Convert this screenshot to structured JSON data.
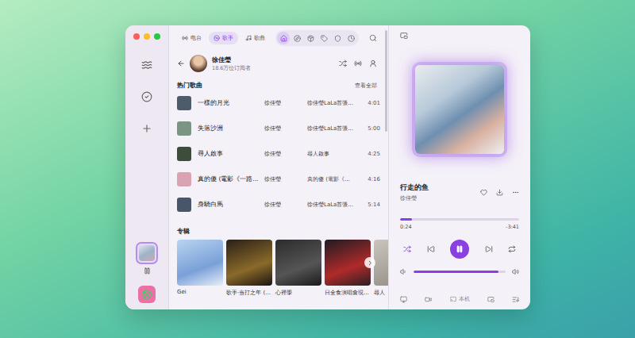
{
  "sidebar": {
    "items": [
      {
        "kind": "waves",
        "selected": false
      },
      {
        "kind": "check",
        "selected": false
      },
      {
        "kind": "plus",
        "selected": false
      }
    ],
    "now_playing_selected": true
  },
  "tabs": [
    {
      "label": "电台",
      "kind": "radio",
      "selected": false
    },
    {
      "label": "歌手",
      "kind": "disc",
      "selected": true
    },
    {
      "label": "歌曲",
      "kind": "music",
      "selected": false
    }
  ],
  "nav_icons": [
    {
      "kind": "home",
      "selected": true
    },
    {
      "kind": "compass",
      "selected": false
    },
    {
      "kind": "package",
      "selected": false
    },
    {
      "kind": "tag",
      "selected": false
    },
    {
      "kind": "shield",
      "selected": false
    },
    {
      "kind": "clock",
      "selected": false
    }
  ],
  "artist": {
    "name": "徐佳瑩",
    "subscribers": "18.6万位订阅者"
  },
  "popular": {
    "title": "热门歌曲",
    "see_all": "查看全部",
    "rows": [
      {
        "title": "一樣的月光",
        "artist": "徐佳瑩",
        "album": "徐佳瑩LaLa首張...",
        "duration": "4:01"
      },
      {
        "title": "失落沙洲",
        "artist": "徐佳瑩",
        "album": "徐佳瑩LaLa首張...",
        "duration": "5:00"
      },
      {
        "title": "尋人啟事",
        "artist": "徐佳瑩",
        "album": "尋人啟事",
        "duration": "4:25"
      },
      {
        "title": "真的傻 (電影《一路...",
        "artist": "徐佳瑩",
        "album": "真的傻 (電影《...",
        "duration": "4:16"
      },
      {
        "title": "身騎白馬",
        "artist": "徐佳瑩",
        "album": "徐佳瑩LaLa首張...",
        "duration": "5:14"
      }
    ]
  },
  "albums": {
    "title": "专辑",
    "items": [
      {
        "title": "Gei"
      },
      {
        "title": "歌手·当打之年 (..."
      },
      {
        "title": "心裡學"
      },
      {
        "title": "日全食演唱會現..."
      },
      {
        "title": "尋人"
      }
    ]
  },
  "now_playing": {
    "title": "行走的鱼",
    "artist": "徐佳瑩",
    "liked": false,
    "elapsed": "0:24",
    "remaining": "-3:41",
    "level": 0.1,
    "playing": true,
    "shuffle": true,
    "repeat": false,
    "volume": 0.92
  },
  "footer": {
    "device": "本机"
  }
}
